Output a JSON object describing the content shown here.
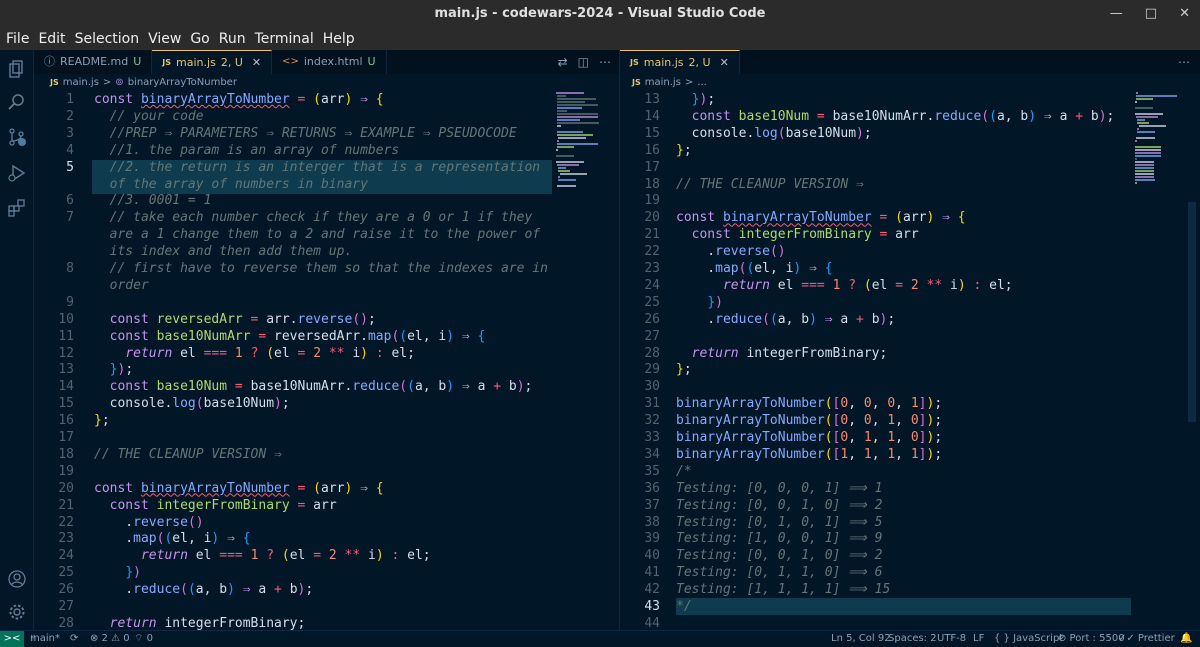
{
  "window": {
    "title": "main.js - codewars-2024 - Visual Studio Code"
  },
  "menu": [
    "File",
    "Edit",
    "Selection",
    "View",
    "Go",
    "Run",
    "Terminal",
    "Help"
  ],
  "left_tabs": [
    {
      "icon": "ⓘ",
      "label": "README.md",
      "status": "U"
    },
    {
      "icon": "JS",
      "label": "main.js",
      "status": "2, U"
    },
    {
      "icon": "<>",
      "label": "index.html",
      "status": "U"
    }
  ],
  "right_tabs": [
    {
      "icon": "JS",
      "label": "main.js",
      "status": "2, U"
    }
  ],
  "left_crumb": {
    "file": "main.js",
    "sep": ">",
    "symbol": "binaryArrayToNumber"
  },
  "right_crumb": {
    "file": "main.js",
    "sep": ">",
    "more": "..."
  },
  "left_lines": [
    {
      "n": "1",
      "h": "<span class='k'>const</span> <span class='fn und'>binaryArrayToNumber</span> <span class='op'>=</span> <span class='pb'>(</span><span class='vr'>arr</span><span class='pb'>)</span> <span class='k'>⇒</span> <span class='pb'>{</span>"
    },
    {
      "n": "2",
      "h": "  <span class='cm'>// your code</span>"
    },
    {
      "n": "3",
      "h": "  <span class='cm'>//PREP ⇒ PARAMETERS ⇒ RETURNS ⇒ EXAMPLE ⇒ PSEUDOCODE</span>"
    },
    {
      "n": "4",
      "h": "  <span class='cm'>//1. the param is an array of numbers</span>"
    },
    {
      "n": "5",
      "h": "  <span class='cm'>//2. the return is an interger that is a representation</span>"
    },
    {
      "n": "",
      "h": "  <span class='cm'>of the array of numbers in binary</span>"
    },
    {
      "n": "6",
      "h": "  <span class='cm'>//3. 0001 = 1</span>"
    },
    {
      "n": "7",
      "h": "  <span class='cm'>// take each number check if they are a 0 or 1 if they</span>"
    },
    {
      "n": "",
      "h": "  <span class='cm'>are a 1 change them to a 2 and raise it to the power of</span>"
    },
    {
      "n": "",
      "h": "  <span class='cm'>its index and then add them up.</span>"
    },
    {
      "n": "8",
      "h": "  <span class='cm'>// first have to reverse them so that the indexes are in</span>"
    },
    {
      "n": "",
      "h": "  <span class='cm'>order</span>"
    },
    {
      "n": "9",
      "h": ""
    },
    {
      "n": "10",
      "h": "  <span class='k'>const</span> <span class='fy'>reversedArr</span> <span class='op'>=</span> <span class='vr'>arr</span>.<span class='fn'>reverse</span><span class='pp'>()</span>;"
    },
    {
      "n": "11",
      "h": "  <span class='k'>const</span> <span class='fy'>base10NumArr</span> <span class='op'>=</span> <span class='vr'>reversedArr</span>.<span class='fn'>map</span><span class='pp'>(</span><span class='pc'>(</span><span class='vr'>el</span>, <span class='vr'>i</span><span class='pc'>)</span> <span class='k'>⇒</span> <span class='pc'>{</span>"
    },
    {
      "n": "12",
      "h": "    <span class='kb'>return</span> <span class='vr'>el</span> <span class='op'>===</span> <span class='nm'>1</span> <span class='op'>?</span> <span class='pb'>(</span><span class='vr'>el</span> <span class='op'>=</span> <span class='nm'>2</span> <span class='op'>**</span> <span class='vr'>i</span><span class='pb'>)</span> <span class='op'>:</span> <span class='vr'>el</span>;"
    },
    {
      "n": "13",
      "h": "  <span class='pc'>}</span><span class='pp'>)</span>;"
    },
    {
      "n": "14",
      "h": "  <span class='k'>const</span> <span class='fy'>base10Num</span> <span class='op'>=</span> <span class='vr'>base10NumArr</span>.<span class='fn'>reduce</span><span class='pp'>(</span><span class='pc'>(</span><span class='vr'>a</span>, <span class='vr'>b</span><span class='pc'>)</span> <span class='k'>⇒</span> <span class='vr'>a</span> <span class='op'>+</span> <span class='vr'>b</span><span class='pp'>)</span>;"
    },
    {
      "n": "15",
      "h": "  <span class='vr'>console</span>.<span class='fn'>log</span><span class='pp'>(</span><span class='vr'>base10Num</span><span class='pp'>)</span>;"
    },
    {
      "n": "16",
      "h": "<span class='pb'>}</span>;"
    },
    {
      "n": "17",
      "h": ""
    },
    {
      "n": "18",
      "h": "<span class='cm'>// THE CLEANUP VERSION ⇒</span>"
    },
    {
      "n": "19",
      "h": ""
    },
    {
      "n": "20",
      "h": "<span class='k'>const</span> <span class='fn und'>binaryArrayToNumber</span> <span class='op'>=</span> <span class='pb'>(</span><span class='vr'>arr</span><span class='pb'>)</span> <span class='k'>⇒</span> <span class='pb'>{</span>"
    },
    {
      "n": "21",
      "h": "  <span class='k'>const</span> <span class='fy'>integerFromBinary</span> <span class='op'>=</span> <span class='vr'>arr</span>"
    },
    {
      "n": "22",
      "h": "    .<span class='fn'>reverse</span><span class='pp'>()</span>"
    },
    {
      "n": "23",
      "h": "    .<span class='fn'>map</span><span class='pp'>(</span><span class='pc'>(</span><span class='vr'>el</span>, <span class='vr'>i</span><span class='pc'>)</span> <span class='k'>⇒</span> <span class='pc'>{</span>"
    },
    {
      "n": "24",
      "h": "      <span class='kb'>return</span> <span class='vr'>el</span> <span class='op'>===</span> <span class='nm'>1</span> <span class='op'>?</span> <span class='pb'>(</span><span class='vr'>el</span> <span class='op'>=</span> <span class='nm'>2</span> <span class='op'>**</span> <span class='vr'>i</span><span class='pb'>)</span> <span class='op'>:</span> <span class='vr'>el</span>;"
    },
    {
      "n": "25",
      "h": "    <span class='pc'>}</span><span class='pp'>)</span>"
    },
    {
      "n": "26",
      "h": "    .<span class='fn'>reduce</span><span class='pp'>(</span><span class='pc'>(</span><span class='vr'>a</span>, <span class='vr'>b</span><span class='pc'>)</span> <span class='k'>⇒</span> <span class='vr'>a</span> <span class='op'>+</span> <span class='vr'>b</span><span class='pp'>)</span>;"
    },
    {
      "n": "27",
      "h": ""
    },
    {
      "n": "28",
      "h": "  <span class='kb'>return</span> <span class='vr'>integerFromBinary</span>;"
    }
  ],
  "right_lines": [
    {
      "n": "13",
      "h": "  <span class='pc'>}</span><span class='pp'>)</span>;"
    },
    {
      "n": "14",
      "h": "  <span class='k'>const</span> <span class='fy'>base10Num</span> <span class='op'>=</span> <span class='vr'>base10NumArr</span>.<span class='fn'>reduce</span><span class='pp'>(</span><span class='pc'>(</span><span class='vr'>a</span>, <span class='vr'>b</span><span class='pc'>)</span> <span class='k'>⇒</span> <span class='vr'>a</span> <span class='op'>+</span> <span class='vr'>b</span><span class='pp'>)</span>;"
    },
    {
      "n": "15",
      "h": "  <span class='vr'>console</span>.<span class='fn'>log</span><span class='pp'>(</span><span class='vr'>base10Num</span><span class='pp'>)</span>;"
    },
    {
      "n": "16",
      "h": "<span class='pb'>}</span>;"
    },
    {
      "n": "17",
      "h": ""
    },
    {
      "n": "18",
      "h": "<span class='cm'>// THE CLEANUP VERSION ⇒</span>"
    },
    {
      "n": "19",
      "h": ""
    },
    {
      "n": "20",
      "h": "<span class='k'>const</span> <span class='fn und'>binaryArrayToNumber</span> <span class='op'>=</span> <span class='pb'>(</span><span class='vr'>arr</span><span class='pb'>)</span> <span class='k'>⇒</span> <span class='pb'>{</span>"
    },
    {
      "n": "21",
      "h": "  <span class='k'>const</span> <span class='fy'>integerFromBinary</span> <span class='op'>=</span> <span class='vr'>arr</span>"
    },
    {
      "n": "22",
      "h": "    .<span class='fn'>reverse</span><span class='pp'>()</span>"
    },
    {
      "n": "23",
      "h": "    .<span class='fn'>map</span><span class='pp'>(</span><span class='pc'>(</span><span class='vr'>el</span>, <span class='vr'>i</span><span class='pc'>)</span> <span class='k'>⇒</span> <span class='pc'>{</span>"
    },
    {
      "n": "24",
      "h": "      <span class='kb'>return</span> <span class='vr'>el</span> <span class='op'>===</span> <span class='nm'>1</span> <span class='op'>?</span> <span class='pb'>(</span><span class='vr'>el</span> <span class='op'>=</span> <span class='nm'>2</span> <span class='op'>**</span> <span class='vr'>i</span><span class='pb'>)</span> <span class='op'>:</span> <span class='vr'>el</span>;"
    },
    {
      "n": "25",
      "h": "    <span class='pc'>}</span><span class='pp'>)</span>"
    },
    {
      "n": "26",
      "h": "    .<span class='fn'>reduce</span><span class='pp'>(</span><span class='pc'>(</span><span class='vr'>a</span>, <span class='vr'>b</span><span class='pc'>)</span> <span class='k'>⇒</span> <span class='vr'>a</span> <span class='op'>+</span> <span class='vr'>b</span><span class='pp'>)</span>;"
    },
    {
      "n": "27",
      "h": ""
    },
    {
      "n": "28",
      "h": "  <span class='kb'>return</span> <span class='vr'>integerFromBinary</span>;"
    },
    {
      "n": "29",
      "h": "<span class='pb'>}</span>;"
    },
    {
      "n": "30",
      "h": ""
    },
    {
      "n": "31",
      "h": "<span class='fn'>binaryArrayToNumber</span><span class='pb'>(</span><span class='pp'>[</span><span class='nm'>0</span>, <span class='nm'>0</span>, <span class='nm'>0</span>, <span class='nm'>1</span><span class='pp'>]</span><span class='pb'>)</span>;"
    },
    {
      "n": "32",
      "h": "<span class='fn'>binaryArrayToNumber</span><span class='pb'>(</span><span class='pp'>[</span><span class='nm'>0</span>, <span class='nm'>0</span>, <span class='nm'>1</span>, <span class='nm'>0</span><span class='pp'>]</span><span class='pb'>)</span>;"
    },
    {
      "n": "33",
      "h": "<span class='fn'>binaryArrayToNumber</span><span class='pb'>(</span><span class='pp'>[</span><span class='nm'>0</span>, <span class='nm'>1</span>, <span class='nm'>1</span>, <span class='nm'>0</span><span class='pp'>]</span><span class='pb'>)</span>;"
    },
    {
      "n": "34",
      "h": "<span class='fn'>binaryArrayToNumber</span><span class='pb'>(</span><span class='pp'>[</span><span class='nm'>1</span>, <span class='nm'>1</span>, <span class='nm'>1</span>, <span class='nm'>1</span><span class='pp'>]</span><span class='pb'>)</span>;"
    },
    {
      "n": "35",
      "h": "<span class='cm'>/*</span>"
    },
    {
      "n": "36",
      "h": "<span class='cm'>Testing: [0, 0, 0, 1] ⟹ 1</span>"
    },
    {
      "n": "37",
      "h": "<span class='cm'>Testing: [0, 0, 1, 0] ⟹ 2</span>"
    },
    {
      "n": "38",
      "h": "<span class='cm'>Testing: [0, 1, 0, 1] ⟹ 5</span>"
    },
    {
      "n": "39",
      "h": "<span class='cm'>Testing: [1, 0, 0, 1] ⟹ 9</span>"
    },
    {
      "n": "40",
      "h": "<span class='cm'>Testing: [0, 0, 1, 0] ⟹ 2</span>"
    },
    {
      "n": "41",
      "h": "<span class='cm'>Testing: [0, 1, 1, 0] ⟹ 6</span>"
    },
    {
      "n": "42",
      "h": "<span class='cm'>Testing: [1, 1, 1, 1] ⟹ 15</span>"
    },
    {
      "n": "43",
      "h": "<span class='cm'>*/</span>"
    },
    {
      "n": "44",
      "h": ""
    }
  ],
  "status": {
    "remote": "><",
    "branch": "main*",
    "sync": "⟳",
    "problems": "⊗ 2 ⚠ 0",
    "ports": "⌔ 0",
    "position": "Ln 5, Col 92",
    "spaces": "Spaces: 2",
    "encoding": "UTF-8",
    "eol": "LF",
    "language": "{ } JavaScript",
    "port": "⊘ Port : 5500",
    "prettier": "✓✓ Prettier",
    "bell": "🔔"
  },
  "colors": {
    "background": "#011627",
    "accent": "#e8c46a",
    "line_highlight": "#0e3b4e"
  }
}
